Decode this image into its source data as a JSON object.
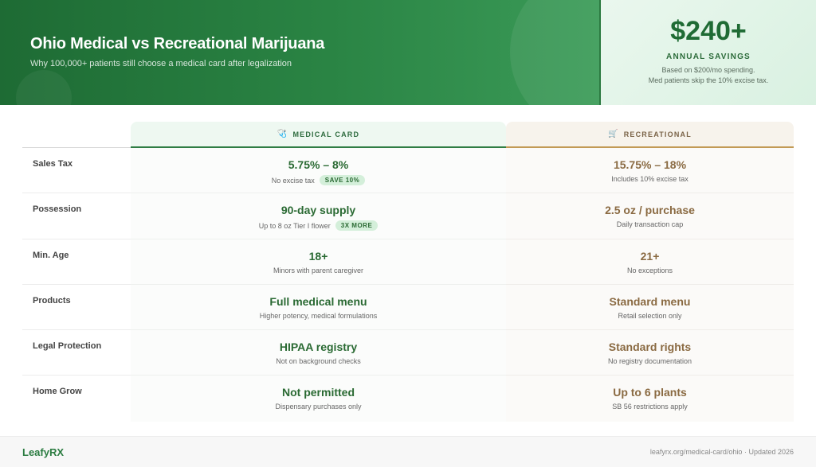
{
  "header": {
    "title": "Ohio Medical vs Recreational Marijuana",
    "subtitle": "Why 100,000+ patients still choose a medical card after legalization"
  },
  "savings": {
    "amount": "$240+",
    "label": "ANNUAL SAVINGS",
    "note_line1": "Based on $200/mo spending.",
    "note_line2": "Med patients skip the 10% excise tax."
  },
  "columns": {
    "medical": {
      "icon": "🩺",
      "icon_name": "stethoscope-icon",
      "label": "MEDICAL CARD"
    },
    "recreational": {
      "icon": "🛒",
      "icon_name": "shopping-cart-icon",
      "label": "RECREATIONAL"
    }
  },
  "rows": [
    {
      "label": "Sales Tax",
      "medical": {
        "value": "5.75% – 8%",
        "sub": "No excise tax",
        "badge": "SAVE 10%"
      },
      "recreational": {
        "value": "15.75% – 18%",
        "sub": "Includes 10% excise tax"
      }
    },
    {
      "label": "Possession",
      "medical": {
        "value": "90-day supply",
        "sub": "Up to 8 oz Tier I flower",
        "badge": "3X MORE"
      },
      "recreational": {
        "value": "2.5 oz / purchase",
        "sub": "Daily transaction cap"
      }
    },
    {
      "label": "Min. Age",
      "medical": {
        "value": "18+",
        "sub": "Minors with parent caregiver"
      },
      "recreational": {
        "value": "21+",
        "sub": "No exceptions"
      }
    },
    {
      "label": "Products",
      "medical": {
        "value": "Full medical menu",
        "sub": "Higher potency, medical formulations"
      },
      "recreational": {
        "value": "Standard menu",
        "sub": "Retail selection only"
      }
    },
    {
      "label": "Legal Protection",
      "medical": {
        "value": "HIPAA registry",
        "sub": "Not on background checks"
      },
      "recreational": {
        "value": "Standard rights",
        "sub": "No registry documentation"
      }
    },
    {
      "label": "Home Grow",
      "medical": {
        "value": "Not permitted",
        "sub": "Dispensary purchases only"
      },
      "recreational": {
        "value": "Up to 6 plants",
        "sub": "SB 56 restrictions apply"
      }
    }
  ],
  "footer": {
    "brand": "LeafyRX",
    "note": "leafyrx.org/medical-card/ohio · Updated 2026"
  },
  "colors": {
    "medical_accent": "#2a6a33",
    "recreational_accent": "#8a6a42",
    "hero_green": "#1e6b34"
  }
}
